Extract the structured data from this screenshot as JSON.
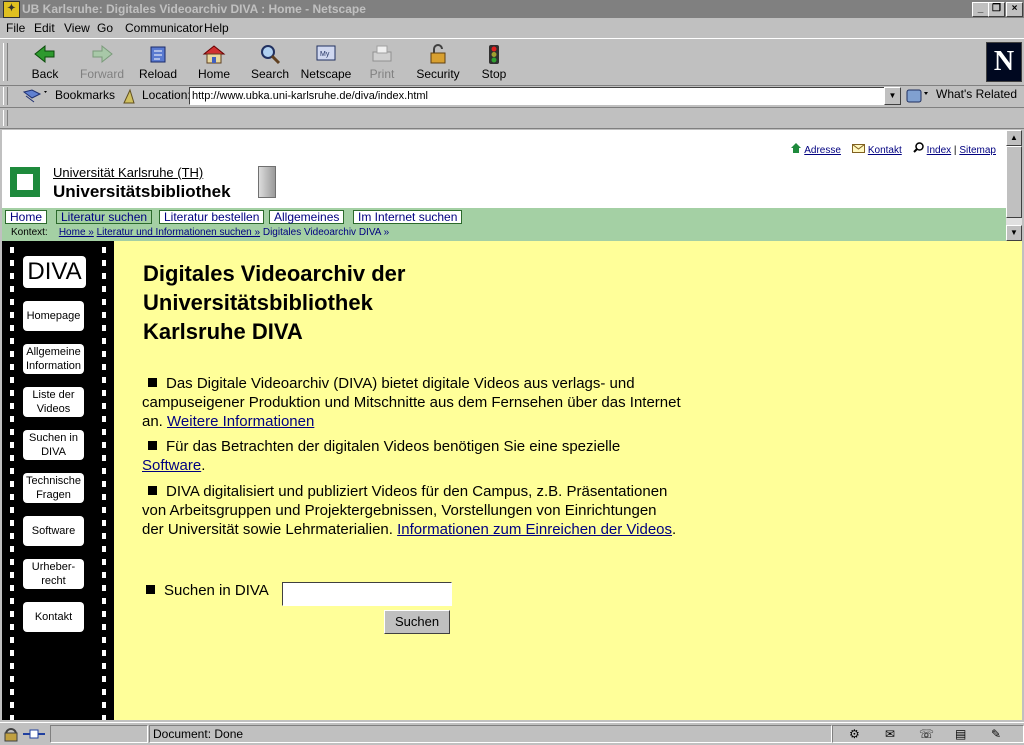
{
  "window": {
    "title": "UB Karlsruhe: Digitales Videoarchiv DIVA : Home - Netscape"
  },
  "menu": [
    "File",
    "Edit",
    "View",
    "Go",
    "Communicator",
    "Help"
  ],
  "toolbar": [
    "Back",
    "Forward",
    "Reload",
    "Home",
    "Search",
    "Netscape",
    "Print",
    "Security",
    "Stop"
  ],
  "location": {
    "bookmarks": "Bookmarks",
    "label": "Location:",
    "url": "http://www.ubka.uni-karlsruhe.de/diva/index.html",
    "related": "What's Related"
  },
  "header": {
    "links": {
      "adresse": "Adresse",
      "kontakt": "Kontakt",
      "index": "Index",
      "sep": "|",
      "sitemap": "Sitemap"
    },
    "university": "Universität Karlsruhe (TH)",
    "library": "Universitätsbibliothek",
    "tabs": [
      "Home",
      "Literatur suchen",
      "Literatur bestellen",
      "Allgemeines",
      "Im Internet suchen"
    ],
    "context": {
      "label": "Kontext:",
      "crumb1": "Home »",
      "crumb2": "Literatur und Informationen suchen »",
      "current": "Digitales Videoarchiv DIVA »"
    }
  },
  "sidebar": {
    "logo": "DIVA",
    "items": [
      "Homepage",
      "Allgemeine Information",
      "Liste der Videos",
      "Suchen in DIVA",
      "Technische Fragen",
      "Software",
      "Urheber-recht",
      "Kontakt"
    ]
  },
  "main": {
    "heading_1": "Digitales Videoarchiv der",
    "heading_2": "Universitätsbibliothek",
    "heading_3": "Karlsruhe DIVA",
    "p1_text": "Das Digitale Videoarchiv (DIVA) bietet digitale Videos aus verlags- und campuseigener Produktion und Mitschnitte aus dem Fernsehen über das Internet an.",
    "p1_link": "Weitere Informationen",
    "p2_text": "Für das Betrachten der digitalen Videos benötigen Sie eine spezielle",
    "p2_link": "Software",
    "p2_end": ".",
    "p3_text": "DIVA digitalisiert und publiziert Videos für den Campus, z.B. Präsentationen von Arbeitsgruppen und Projektergebnissen, Vorstellungen von Einrichtungen der Universität sowie Lehrmaterialien.",
    "p3_link": "Informationen zum Einreichen der Videos",
    "p3_end": ".",
    "search_label": "Suchen in DIVA",
    "search_value": "",
    "search_button": "Suchen"
  },
  "status": {
    "text": "Document: Done"
  }
}
